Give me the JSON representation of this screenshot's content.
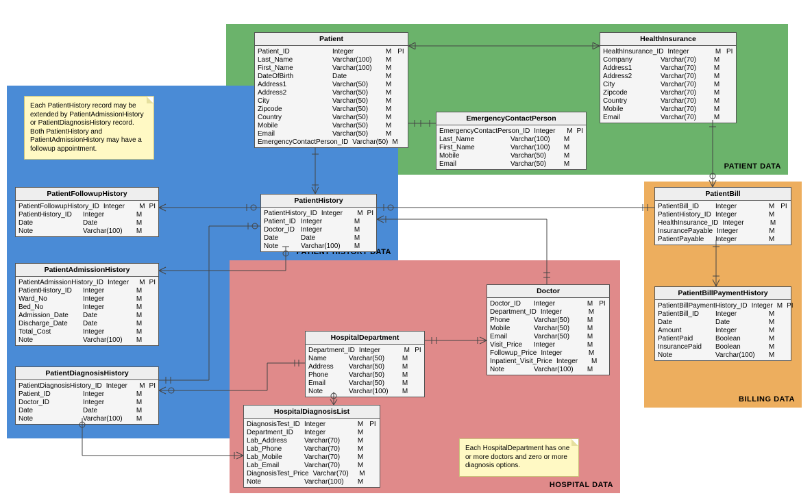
{
  "zones": {
    "green": {
      "label": "PATIENT DATA"
    },
    "blue": {
      "label": "PATIENT HISTORY DATA"
    },
    "red": {
      "label": "HOSPITAL DATA"
    },
    "orange": {
      "label": "BILLING DATA"
    }
  },
  "notes": {
    "n1": "Each PatientHistory record may be extended by PatientAdmissionHistory or PatientDiagnosisHistory record. Both PatientHistory and PatientAdmissionHistory may have a followup appointment.",
    "n2": "Each HospitalDepartment has one or more doctors and zero or more diagnosis options."
  },
  "entities": {
    "Patient": {
      "title": "Patient",
      "rows": [
        [
          "Patient_ID",
          "Integer",
          "M",
          "PI"
        ],
        [
          "Last_Name",
          "Varchar(100)",
          "M",
          ""
        ],
        [
          "First_Name",
          "Varchar(100)",
          "M",
          ""
        ],
        [
          "DateOfBirth",
          "Date",
          "M",
          ""
        ],
        [
          "Address1",
          "Varchar(50)",
          "M",
          ""
        ],
        [
          "Address2",
          "Varchar(50)",
          "M",
          ""
        ],
        [
          "City",
          "Varchar(50)",
          "M",
          ""
        ],
        [
          "Zipcode",
          "Varchar(50)",
          "M",
          ""
        ],
        [
          "Country",
          "Varchar(50)",
          "M",
          ""
        ],
        [
          "Mobile",
          "Varchar(50)",
          "M",
          ""
        ],
        [
          "Email",
          "Varchar(50)",
          "M",
          ""
        ],
        [
          "EmergencyContactPerson_ID",
          "Varchar(50)",
          "M",
          ""
        ]
      ]
    },
    "HealthInsurance": {
      "title": "HealthInsurance",
      "rows": [
        [
          "HealthInsurance_ID",
          "Integer",
          "M",
          "PI"
        ],
        [
          "Company",
          "Varchar(70)",
          "M",
          ""
        ],
        [
          "Address1",
          "Varchar(70)",
          "M",
          ""
        ],
        [
          "Address2",
          "Varchar(70)",
          "M",
          ""
        ],
        [
          "City",
          "Varchar(70)",
          "M",
          ""
        ],
        [
          "Zipcode",
          "Varchar(70)",
          "M",
          ""
        ],
        [
          "Country",
          "Varchar(70)",
          "M",
          ""
        ],
        [
          "Mobile",
          "Varchar(70)",
          "M",
          ""
        ],
        [
          "Email",
          "Varchar(70)",
          "M",
          ""
        ]
      ]
    },
    "EmergencyContactPerson": {
      "title": "EmergencyContactPerson",
      "rows": [
        [
          "EmergencyContactPerson_ID",
          "Integer",
          "M",
          "PI"
        ],
        [
          "Last_Name",
          "Varchar(100)",
          "M",
          ""
        ],
        [
          "First_Name",
          "Varchar(100)",
          "M",
          ""
        ],
        [
          "Mobile",
          "Varchar(50)",
          "M",
          ""
        ],
        [
          "Email",
          "Varchar(50)",
          "M",
          ""
        ]
      ]
    },
    "PatientFollowupHistory": {
      "title": "PatientFollowupHistory",
      "rows": [
        [
          "PatientFollowupHistory_ID",
          "Integer",
          "M",
          "PI"
        ],
        [
          "PatientHistory_ID",
          "Integer",
          "M",
          ""
        ],
        [
          "Date",
          "Date",
          "M",
          ""
        ],
        [
          "Note",
          "Varchar(100)",
          "M",
          ""
        ]
      ]
    },
    "PatientHistory": {
      "title": "PatientHistory",
      "rows": [
        [
          "PatientHistory_ID",
          "Integer",
          "M",
          "PI"
        ],
        [
          "Patient_ID",
          "Integer",
          "M",
          ""
        ],
        [
          "Doctor_ID",
          "Integer",
          "M",
          ""
        ],
        [
          "Date",
          "Date",
          "M",
          ""
        ],
        [
          "Note",
          "Varchar(100)",
          "M",
          ""
        ]
      ]
    },
    "PatientAdmissionHistory": {
      "title": "PatientAdmissionHistory",
      "rows": [
        [
          "PatientAdmissionHistory_ID",
          "Integer",
          "M",
          "PI"
        ],
        [
          "PatientHistory_ID",
          "Integer",
          "M",
          ""
        ],
        [
          "Ward_No",
          "Integer",
          "M",
          ""
        ],
        [
          "Bed_No",
          "Integer",
          "M",
          ""
        ],
        [
          "Admission_Date",
          "Date",
          "M",
          ""
        ],
        [
          "Discharge_Date",
          "Date",
          "M",
          ""
        ],
        [
          "Total_Cost",
          "Integer",
          "M",
          ""
        ],
        [
          "Note",
          "Varchar(100)",
          "M",
          ""
        ]
      ]
    },
    "PatientDiagnosisHistory": {
      "title": "PatientDiagnosisHistory",
      "rows": [
        [
          "PatientDiagnosisHistory_ID",
          "Integer",
          "M",
          "PI"
        ],
        [
          "Patient_ID",
          "Integer",
          "M",
          ""
        ],
        [
          "Doctor_ID",
          "Integer",
          "M",
          ""
        ],
        [
          "Date",
          "Date",
          "M",
          ""
        ],
        [
          "Note",
          "Varchar(100)",
          "M",
          ""
        ]
      ]
    },
    "Doctor": {
      "title": "Doctor",
      "rows": [
        [
          "Doctor_ID",
          "Integer",
          "M",
          "PI"
        ],
        [
          "Department_ID",
          "Integer",
          "M",
          ""
        ],
        [
          "Phone",
          "Varchar(50)",
          "M",
          ""
        ],
        [
          "Mobile",
          "Varchar(50)",
          "M",
          ""
        ],
        [
          "Email",
          "Varchar(50)",
          "M",
          ""
        ],
        [
          "Visit_Price",
          "Integer",
          "M",
          ""
        ],
        [
          "Followup_Price",
          "Integer",
          "M",
          ""
        ],
        [
          "Inpatient_Visit_Price",
          "Integer",
          "M",
          ""
        ],
        [
          "Note",
          "Varchar(100)",
          "M",
          ""
        ]
      ]
    },
    "HospitalDepartment": {
      "title": "HospitalDepartment",
      "rows": [
        [
          "Department_ID",
          "Integer",
          "M",
          "PI"
        ],
        [
          "Name",
          "Varchar(50)",
          "M",
          ""
        ],
        [
          "Address",
          "Varchar(50)",
          "M",
          ""
        ],
        [
          "Phone",
          "Varchar(50)",
          "M",
          ""
        ],
        [
          "Email",
          "Varchar(50)",
          "M",
          ""
        ],
        [
          "Note",
          "Varchar(100)",
          "M",
          ""
        ]
      ]
    },
    "HospitalDiagnosisList": {
      "title": "HospitalDiagnosisList",
      "rows": [
        [
          "DiagnosisTest_ID",
          "Integer",
          "M",
          "PI"
        ],
        [
          "Department_ID",
          "Integer",
          "M",
          ""
        ],
        [
          "Lab_Address",
          "Varchar(70)",
          "M",
          ""
        ],
        [
          "Lab_Phone",
          "Varchar(70)",
          "M",
          ""
        ],
        [
          "Lab_Mobile",
          "Varchar(70)",
          "M",
          ""
        ],
        [
          "Lab_Email",
          "Varchar(70)",
          "M",
          ""
        ],
        [
          "DiagnosisTest_Price",
          "Varchar(70)",
          "M",
          ""
        ],
        [
          "Note",
          "Varchar(100)",
          "M",
          ""
        ]
      ]
    },
    "PatientBill": {
      "title": "PatientBill",
      "rows": [
        [
          "PatientBill_ID",
          "Integer",
          "M",
          "PI"
        ],
        [
          "PatientHistory_ID",
          "Integer",
          "M",
          ""
        ],
        [
          "HealthInsurance_ID",
          "Integer",
          "M",
          ""
        ],
        [
          "InsurancePayable",
          "Integer",
          "M",
          ""
        ],
        [
          "PatientPayable",
          "Integer",
          "M",
          ""
        ]
      ]
    },
    "PatientBillPaymentHistory": {
      "title": "PatientBillPaymentHistory",
      "rows": [
        [
          "PatientBillPaymentHistory_ID",
          "Integer",
          "M",
          "PI"
        ],
        [
          "PatientBill_ID",
          "Integer",
          "M",
          ""
        ],
        [
          "Date",
          "Date",
          "M",
          ""
        ],
        [
          "Amount",
          "Integer",
          "M",
          ""
        ],
        [
          "PatientPaid",
          "Boolean",
          "M",
          ""
        ],
        [
          "InsurancePaid",
          "Boolean",
          "M",
          ""
        ],
        [
          "Note",
          "Varchar(100)",
          "M",
          ""
        ]
      ]
    }
  }
}
